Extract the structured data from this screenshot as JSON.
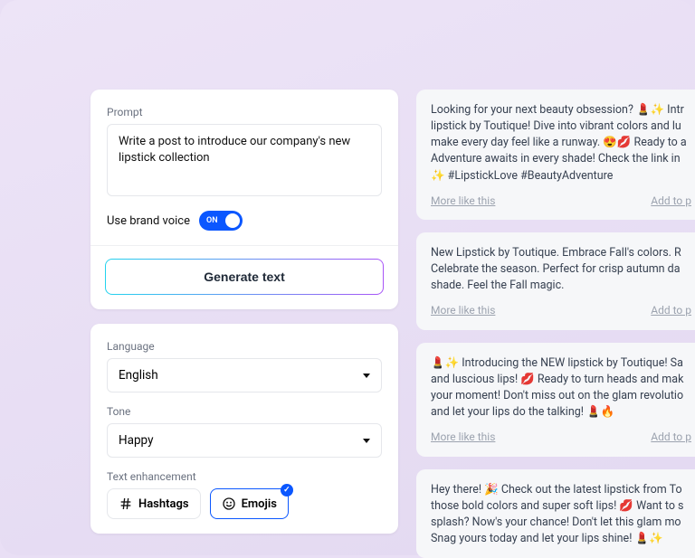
{
  "prompt": {
    "label": "Prompt",
    "value": "Write a post to introduce our company's new lipstick collection"
  },
  "brand_voice": {
    "label": "Use brand voice",
    "state": "ON"
  },
  "generate_label": "Generate text",
  "language": {
    "label": "Language",
    "value": "English"
  },
  "tone": {
    "label": "Tone",
    "value": "Happy"
  },
  "enhancement": {
    "label": "Text enhancement",
    "hashtags": "Hashtags",
    "emojis": "Emojis"
  },
  "link_more": "More like this",
  "link_add": "Add to p",
  "results": [
    {
      "text": "Looking for your next beauty obsession? 💄✨ Intr lipstick by Toutique! Dive into vibrant colors and lu make every day feel like a runway. 😍💋 Ready to a Adventure awaits in every shade! Check the link in ✨ #LipstickLove #BeautyAdventure"
    },
    {
      "text": "New Lipstick by Toutique. Embrace Fall's colors. R Celebrate the season. Perfect for crisp autumn da shade. Feel the Fall magic."
    },
    {
      "text": "💄✨ Introducing the NEW lipstick by Toutique! Sa and luscious lips! 💋 Ready to turn heads and mak your moment! Don't miss out on the glam revolutio and let your lips do the talking! 💄🔥"
    },
    {
      "text": "Hey there! 🎉 Check out the latest lipstick from To those bold colors and super soft lips! 💋 Want to s splash? Now's your chance! Don't let this glam mo Snag yours today and let your lips shine! 💄✨"
    }
  ]
}
